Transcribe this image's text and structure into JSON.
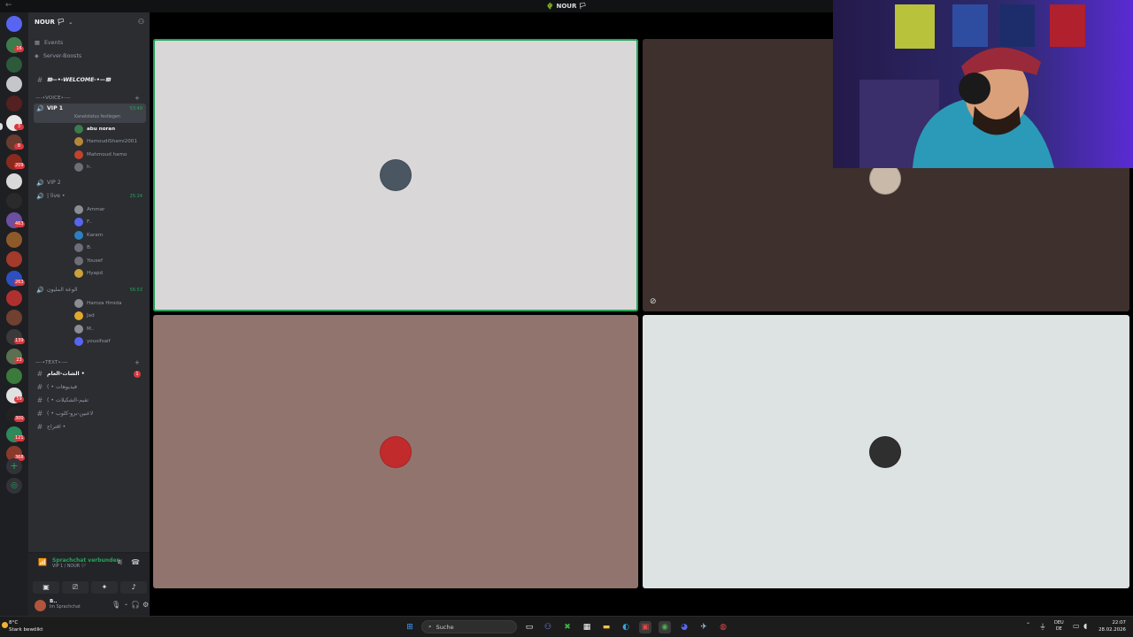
{
  "titlebar": {
    "title": "🌵 NOUR 🏳"
  },
  "server_rail": {
    "badges": [
      "16",
      "3",
      "8",
      "6",
      "209",
      "3",
      "463",
      "263",
      "7",
      "2",
      "9",
      "139",
      "23",
      "59",
      "300",
      "121",
      "368"
    ]
  },
  "guild": {
    "name": "NOUR 🏳"
  },
  "nav": {
    "events": "Events",
    "boosts": "Server-Boosts"
  },
  "channels": {
    "welcome": "𝖂—•-WELCOME-•—𝖂",
    "voice_category": "—-•VOICE•-—",
    "vip1": {
      "name": "VIP 1",
      "status": "Kanalstatus festlegen",
      "timer": "53:49"
    },
    "vip1_members": [
      {
        "name": "abu noran",
        "color": "#3b7a4a"
      },
      {
        "name": "HamoudiShami2001",
        "color": "#b4873a"
      },
      {
        "name": "Mahmoud hamo",
        "color": "#c0432f"
      },
      {
        "name": "h.",
        "color": "#6d6f78"
      }
    ],
    "vip2": {
      "name": "VIP 2"
    },
    "live": {
      "name": "| live •",
      "timer": "25:24"
    },
    "live_members": [
      {
        "name": "Ammar",
        "color": "#8a8d93"
      },
      {
        "name": "F..",
        "color": "#5865f2"
      },
      {
        "name": "Karam",
        "color": "#2f7fc0"
      },
      {
        "name": "B.",
        "color": "#6d6f78"
      },
      {
        "name": "Yousef",
        "color": "#6d6f78"
      },
      {
        "name": "Hyapd",
        "color": "#c9a23a"
      }
    ],
    "third": {
      "name": "الوعة المليون",
      "timer": "56:53"
    },
    "third_members": [
      {
        "name": "Hamza Hmida",
        "color": "#8a8d93"
      },
      {
        "name": "Jad",
        "color": "#e0a82e"
      },
      {
        "name": "M..",
        "color": "#8a8d93"
      },
      {
        "name": "yousifsaif",
        "color": "#5865f2"
      }
    ],
    "text_category": "—-•TEXT•-—",
    "text_channels": [
      {
        "name": "الشات-العام •",
        "unread": "1"
      },
      {
        "name": "( • فيديوهات"
      },
      {
        "name": "( • تقيم-الشكيلات"
      },
      {
        "name": "( • لاعبين-برو-كلوب"
      },
      {
        "name": "اقتراح •"
      }
    ]
  },
  "voice_panel": {
    "connected": "Sprachchat verbunden",
    "location": "VIP 1 / NOUR 🏳"
  },
  "user_panel": {
    "name": "B..",
    "status": "Im Sprachchat"
  },
  "video_tiles": [
    {
      "bg": "#d9d7d8",
      "speaking": true
    },
    {
      "bg": "#3d302d",
      "speaking": false
    },
    {
      "bg": "#92746e",
      "speaking": false
    },
    {
      "bg": "#dde2e2",
      "speaking": false
    }
  ],
  "taskbar": {
    "weather_temp": "8°C",
    "weather_desc": "Stark bewölkt",
    "search": "Suche",
    "lang_top": "DEU",
    "lang_bottom": "DE",
    "time": "22:07",
    "date": "28.02.2026"
  }
}
